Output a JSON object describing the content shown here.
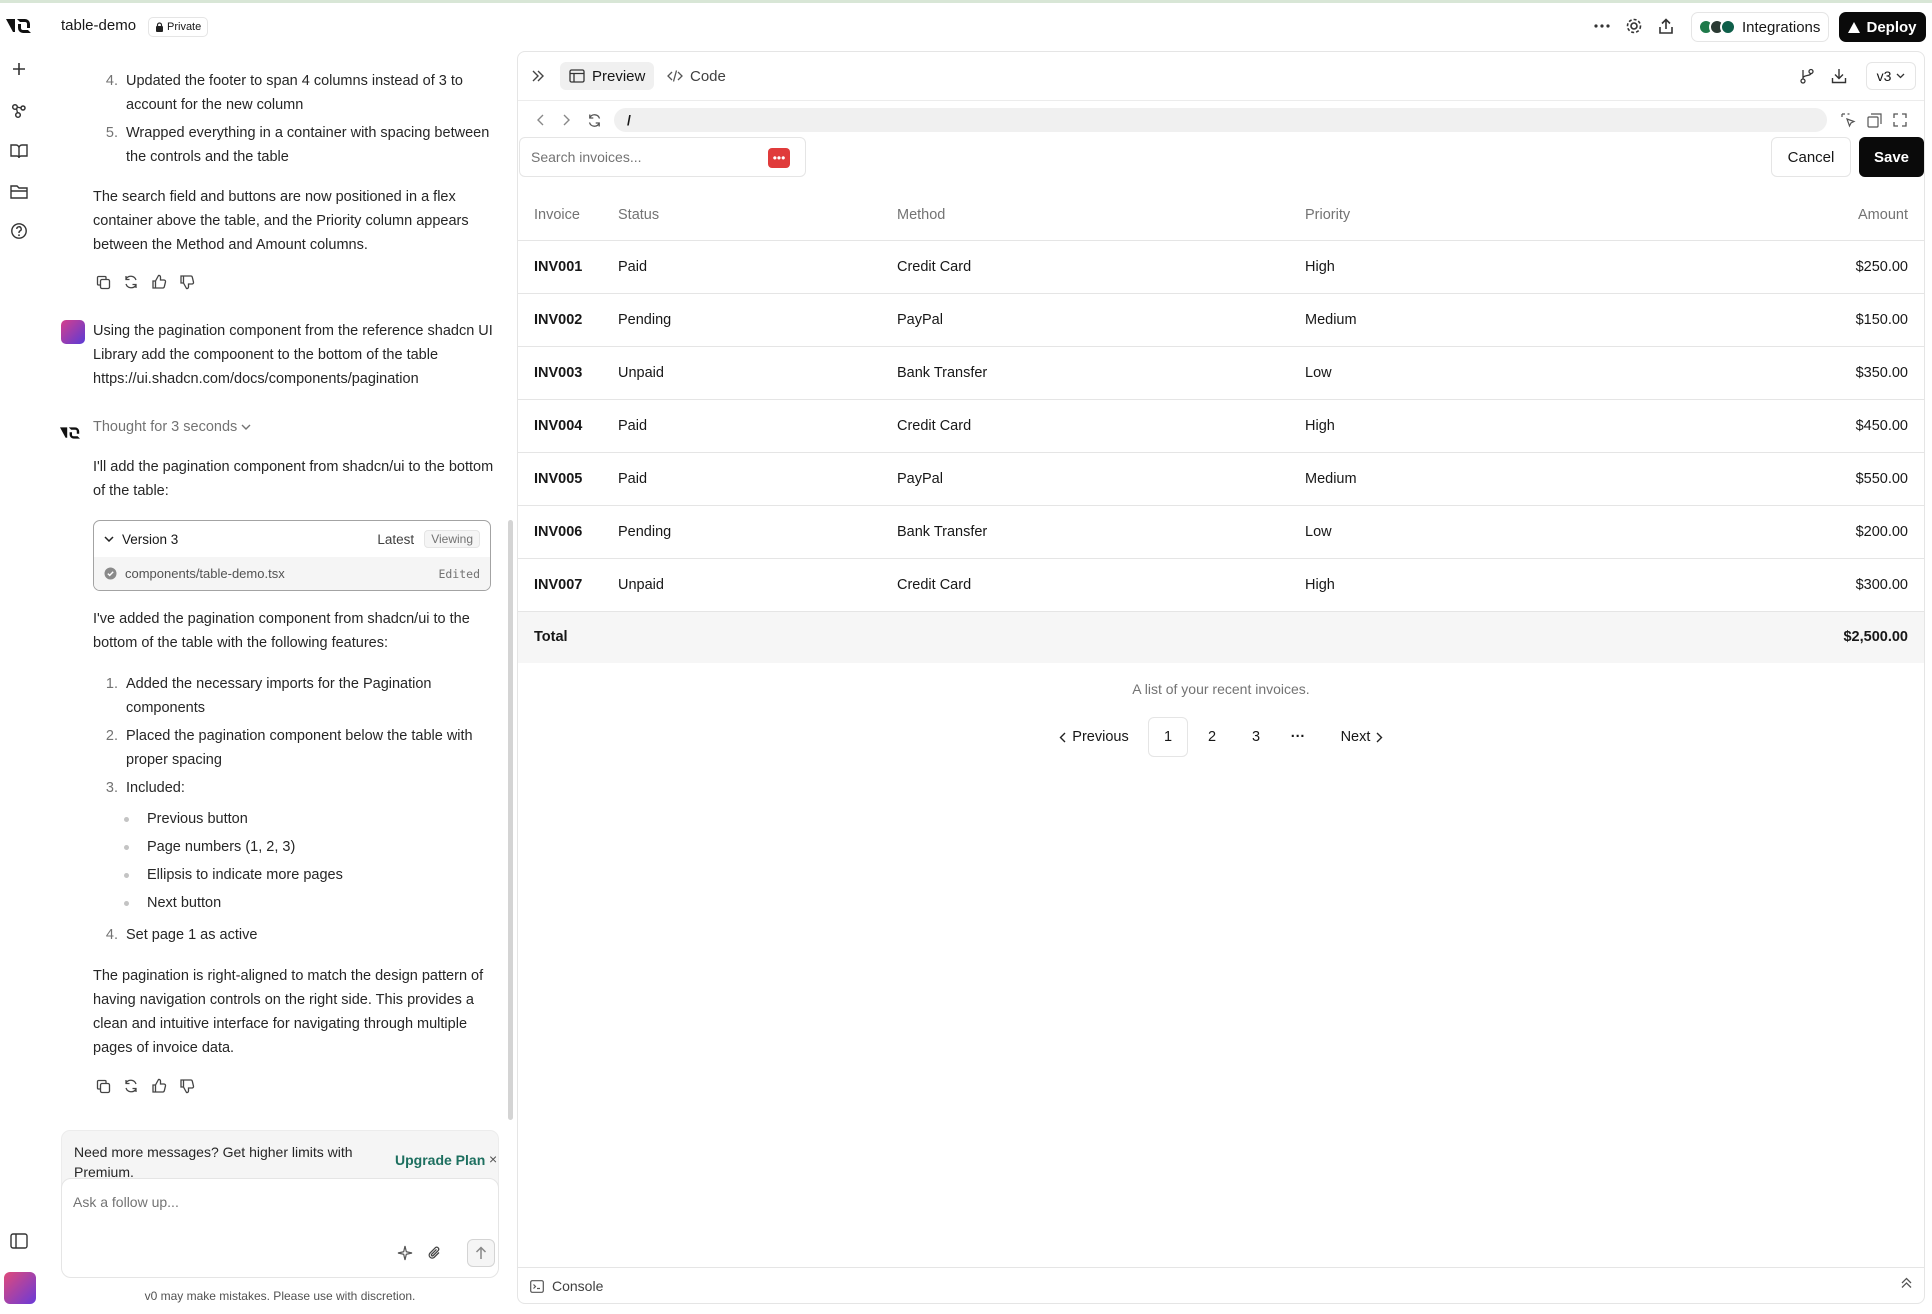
{
  "header": {
    "project_name": "table-demo",
    "visibility": "Private",
    "integrations_label": "Integrations",
    "deploy_label": "Deploy",
    "integration_colors": [
      "#1f7a4a",
      "#2a3a33",
      "#0f5f4a"
    ]
  },
  "chat": {
    "top_items": [
      {
        "n": "4.",
        "text": "Updated the footer to span 4 columns instead of 3 to account for the new column"
      },
      {
        "n": "5.",
        "text": "Wrapped everything in a container with spacing between the controls and the table"
      }
    ],
    "summary": "The search field and buttons are now positioned in a flex container above the table, and the Priority column appears between the Method and Amount columns.",
    "user_message": "Using the pagination component from the reference shadcn UI Library add the compoonent to the bottom of the table https://ui.shadcn.com/docs/components/pagination",
    "thought": "Thought for 3 seconds",
    "intro": "I'll add the pagination component from shadcn/ui to the bottom of the table:",
    "version_card": {
      "title": "Version 3",
      "latest": "Latest",
      "viewing": "Viewing",
      "file": "components/table-demo.tsx",
      "status": "Edited"
    },
    "after_intro": "I've added the pagination component from shadcn/ui to the bottom of the table with the following features:",
    "features": [
      {
        "n": "1.",
        "text": "Added the necessary imports for the Pagination components"
      },
      {
        "n": "2.",
        "text": "Placed the pagination component below the table with proper spacing"
      },
      {
        "n": "3.",
        "text": "Included:"
      },
      {
        "n": "4.",
        "text": "Set page 1 as active"
      }
    ],
    "bullets": [
      "Previous button",
      "Page numbers (1, 2, 3)",
      "Ellipsis to indicate more pages",
      "Next button"
    ],
    "closing": "The pagination is right-aligned to match the design pattern of having navigation controls on the right side. This provides a clean and intuitive interface for navigating through multiple pages of invoice data.",
    "upgrade": {
      "message": "Need more messages? Get higher limits with Premium.",
      "link": "Upgrade Plan",
      "close": "×"
    },
    "input_placeholder": "Ask a follow up...",
    "disclaimer": "v0 may make mistakes. Please use with discretion."
  },
  "preview": {
    "tabs": [
      "Preview",
      "Code"
    ],
    "version": "v3",
    "url": "/",
    "search_placeholder": "Search invoices...",
    "cancel_label": "Cancel",
    "save_label": "Save",
    "table": {
      "headers": [
        "Invoice",
        "Status",
        "Method",
        "Priority",
        "Amount"
      ],
      "rows": [
        [
          "INV001",
          "Paid",
          "Credit Card",
          "High",
          "$250.00"
        ],
        [
          "INV002",
          "Pending",
          "PayPal",
          "Medium",
          "$150.00"
        ],
        [
          "INV003",
          "Unpaid",
          "Bank Transfer",
          "Low",
          "$350.00"
        ],
        [
          "INV004",
          "Paid",
          "Credit Card",
          "High",
          "$450.00"
        ],
        [
          "INV005",
          "Paid",
          "PayPal",
          "Medium",
          "$550.00"
        ],
        [
          "INV006",
          "Pending",
          "Bank Transfer",
          "Low",
          "$200.00"
        ],
        [
          "INV007",
          "Unpaid",
          "Credit Card",
          "High",
          "$300.00"
        ]
      ],
      "footer_label": "Total",
      "footer_amount": "$2,500.00"
    },
    "caption": "A list of your recent invoices.",
    "pagination": {
      "previous": "Previous",
      "pages": [
        "1",
        "2",
        "3"
      ],
      "active_page": "1",
      "ellipsis": "···",
      "next": "Next"
    },
    "console_label": "Console"
  }
}
